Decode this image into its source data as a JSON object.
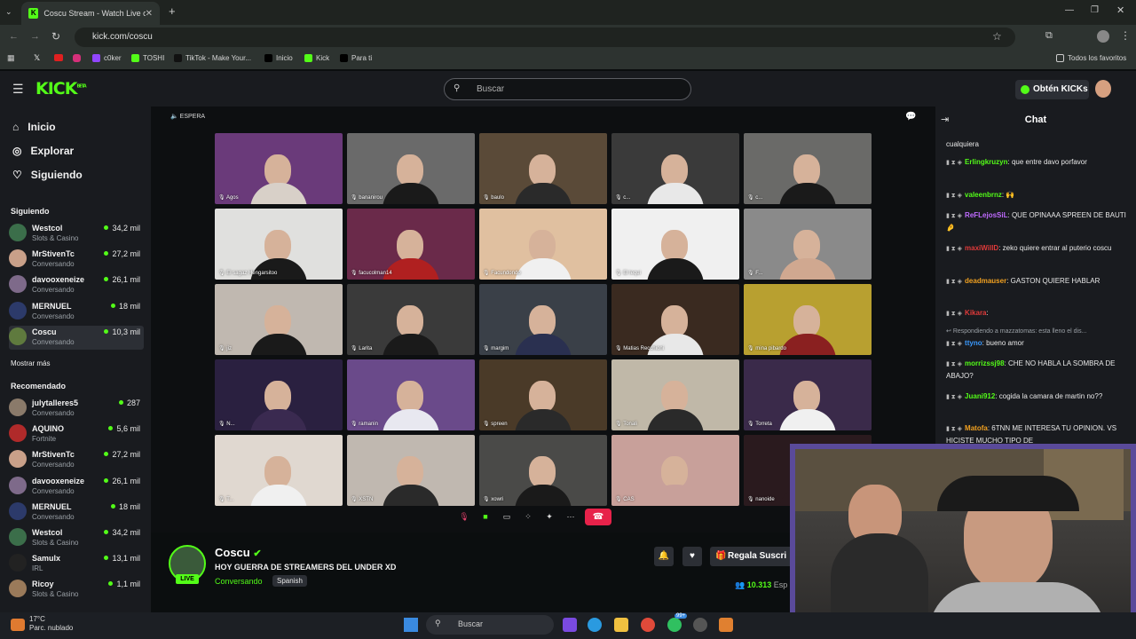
{
  "browser": {
    "tab_title": "Coscu Stream - Watch Live on",
    "url": "kick.com/coscu",
    "bookmarks": [
      "c0ker",
      "TOSHI",
      "TikTok - Make Your...",
      "Inicio",
      "Kick",
      "Para ti"
    ],
    "other_bookmarks": "Todos los favoritos"
  },
  "header": {
    "logo": "KICK",
    "logo_badge": "BETA",
    "search_placeholder": "Buscar",
    "get_kicks": "Obtén KICKs"
  },
  "nav": {
    "home": "Inicio",
    "explore": "Explorar",
    "following": "Siguiendo"
  },
  "sidebar": {
    "following_title": "Siguiendo",
    "following": [
      {
        "name": "Westcol",
        "category": "Slots & Casino",
        "viewers": "34,2 mil",
        "color": "#3b6e4a"
      },
      {
        "name": "MrStivenTc",
        "category": "Conversando",
        "viewers": "27,2 mil",
        "color": "#c9a089"
      },
      {
        "name": "davooxeneize",
        "category": "Conversando",
        "viewers": "26,1 mil",
        "color": "#7e6a8a"
      },
      {
        "name": "MERNUEL",
        "category": "Conversando",
        "viewers": "18 mil",
        "color": "#2c3a6a"
      },
      {
        "name": "Coscu",
        "category": "Conversando",
        "viewers": "10,3 mil",
        "color": "#5f7a3e"
      }
    ],
    "show_more": "Mostrar más",
    "recommended_title": "Recomendado",
    "recommended": [
      {
        "name": "julytalleres5",
        "category": "Conversando",
        "viewers": "287",
        "color": "#8a7a6a"
      },
      {
        "name": "AQUINO",
        "category": "Fortnite",
        "viewers": "5,6 mil",
        "color": "#b02a2a"
      },
      {
        "name": "MrStivenTc",
        "category": "Conversando",
        "viewers": "27,2 mil",
        "color": "#c9a089"
      },
      {
        "name": "davooxeneize",
        "category": "Conversando",
        "viewers": "26,1 mil",
        "color": "#7e6a8a"
      },
      {
        "name": "MERNUEL",
        "category": "Conversando",
        "viewers": "18 mil",
        "color": "#2c3a6a"
      },
      {
        "name": "Westcol",
        "category": "Slots & Casino",
        "viewers": "34,2 mil",
        "color": "#3b6e4a"
      },
      {
        "name": "Samulx",
        "category": "IRL",
        "viewers": "13,1 mil",
        "color": "#222222"
      },
      {
        "name": "Ricoy",
        "category": "Slots & Casino",
        "viewers": "1,1 mil",
        "color": "#9a7a5a"
      }
    ]
  },
  "video": {
    "status": "ESPERA",
    "participants": [
      {
        "label": "Agos",
        "bg": "#6a3a7a",
        "shirt": "#d8d0c8"
      },
      {
        "label": "bananirou",
        "bg": "#6a6a6a",
        "shirt": "#1a1a1a"
      },
      {
        "label": "baulo",
        "bg": "#5a4a38",
        "shirt": "#2a2a2a"
      },
      {
        "label": "c...",
        "bg": "#3a3a3a",
        "shirt": "#e8e8e8"
      },
      {
        "label": "c...",
        "bg": "#6a6a68",
        "shirt": "#1a1a1a"
      },
      {
        "label": "El sagaz Hengarsitoo",
        "bg": "#e0e0de",
        "shirt": "#1a1a1a"
      },
      {
        "label": "facucolman14",
        "bg": "#6a2a4a",
        "shirt": "#b02020"
      },
      {
        "label": "Facundondo",
        "bg": "#e0c0a0",
        "shirt": "#f0f0f0"
      },
      {
        "label": "El lequi",
        "bg": "#f0f0f0",
        "shirt": "#1a1a1a"
      },
      {
        "label": "F...",
        "bg": "#8a8a8a",
        "shirt": "#d0a890"
      },
      {
        "label": "jiz",
        "bg": "#c0b8b0",
        "shirt": "#1a1a1a"
      },
      {
        "label": "Larita",
        "bg": "#3a3a3a",
        "shirt": "#1a1a1a"
      },
      {
        "label": "margim",
        "bg": "#3a4048",
        "shirt": "#2a3050"
      },
      {
        "label": "Matias Recchioni",
        "bg": "#3a2a20",
        "shirt": "#e8e8e8"
      },
      {
        "label": "mina pibardo",
        "bg": "#b8a030",
        "shirt": "#8a2020"
      },
      {
        "label": "N...",
        "bg": "#2a2040",
        "shirt": "#3a2a50"
      },
      {
        "label": "ramanin",
        "bg": "#6a4a8a",
        "shirt": "#e8e8f0"
      },
      {
        "label": "spreen",
        "bg": "#4a3a28",
        "shirt": "#2a2a2a"
      },
      {
        "label": "Tonali",
        "bg": "#c0b8a8",
        "shirt": "#2a2a2a"
      },
      {
        "label": "Torreta",
        "bg": "#3a2a4a",
        "shirt": "#f0f0f0"
      },
      {
        "label": "T...",
        "bg": "#e0d8d0",
        "shirt": "#f0f0f0"
      },
      {
        "label": "XSTN",
        "bg": "#c0b8b0",
        "shirt": "#2a2a2a"
      },
      {
        "label": "xowri",
        "bg": "#4a4a48",
        "shirt": "#1a1a1a"
      },
      {
        "label": "CAS",
        "bg": "#c8a09a",
        "shirt": "#c8a09a"
      },
      {
        "label": "nanoide",
        "bg": "#2a1a1e",
        "shirt": "#2a1a1e"
      }
    ]
  },
  "stream": {
    "streamer": "Coscu",
    "title": "HOY GUERRA DE STREAMERS DEL UNDER XD",
    "category": "Conversando",
    "language": "Spanish",
    "live_label": "LIVE",
    "subscribe": "Regala Suscri",
    "viewers": "10.313",
    "viewers_suffix": "Esp"
  },
  "chat": {
    "title": "Chat",
    "top_fragment": "cualquiera",
    "messages": [
      {
        "user": "Erlingkruzyn",
        "color": "#53fc18",
        "text": "que entre davo porfavor"
      },
      {
        "user": "valeenbrnz",
        "color": "#53fc18",
        "text": "🙌"
      },
      {
        "user": "ReFLejosSiL",
        "color": "#c06bff",
        "text": "QUE OPINAAA SPREEN DE BAUTI 🤌"
      },
      {
        "user": "maxiWillD",
        "color": "#e03a3a",
        "text": "zeko quiere entrar al puterio coscu"
      },
      {
        "user": "deadmauser",
        "color": "#f0a020",
        "text": "GASTON QUIERE HABLAR"
      },
      {
        "user": "Kikara",
        "color": "#e03a3a",
        "text": ""
      },
      {
        "user": "ttyno",
        "color": "#3a9aff",
        "text": "bueno amor"
      },
      {
        "user": "morrizssj98",
        "color": "#53fc18",
        "text": "CHE NO HABLA LA SOMBRA DE ABAJO?"
      },
      {
        "user": "Juani912",
        "color": "#53fc18",
        "text": "cogida la camara de martin no??"
      },
      {
        "user": "Matofa",
        "color": "#f0a020",
        "text": "6TNN ME INTERESA TU OPINION. VS HICISTE MUCHO TIPO DE"
      }
    ],
    "reply_note": "Respondiendo a mazzatomas: esta lleno el dis..."
  },
  "taskbar": {
    "temp": "17°C",
    "weather": "Parc. nublado",
    "search": "Buscar",
    "badge": "99+"
  }
}
